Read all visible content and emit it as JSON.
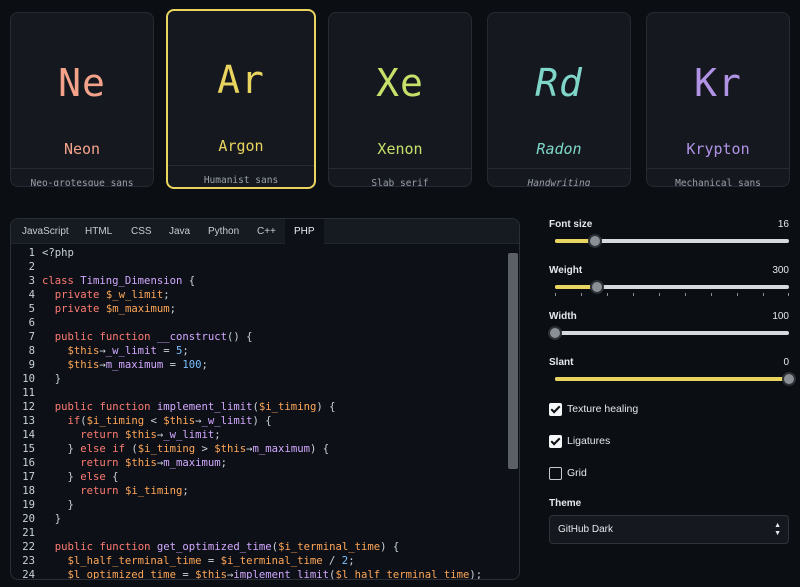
{
  "fonts": [
    {
      "symbol": "Ne",
      "name": "Neon",
      "description": "Neo-grotesque sans",
      "color": "#f4a38a",
      "selected": false
    },
    {
      "symbol": "Ar",
      "name": "Argon",
      "description": "Humanist sans",
      "color": "#e9d45f",
      "selected": true
    },
    {
      "symbol": "Xe",
      "name": "Xenon",
      "description": "Slab serif",
      "color": "#c6e06a",
      "selected": false
    },
    {
      "symbol": "Rd",
      "name": "Radon",
      "description": "Handwriting",
      "color": "#7fd6c8",
      "selected": false
    },
    {
      "symbol": "Kr",
      "name": "Krypton",
      "description": "Mechanical sans",
      "color": "#b193e6",
      "selected": false
    }
  ],
  "editor": {
    "tabs": [
      "JavaScript",
      "HTML",
      "CSS",
      "Java",
      "Python",
      "C++",
      "PHP"
    ],
    "active_tab": "PHP",
    "code_lines": [
      "<?php",
      "",
      "class Timing_Dimension {",
      "  private $_w_limit;",
      "  private $m_maximum;",
      "",
      "  public function __construct() {",
      "    $this→_w_limit = 5;",
      "    $this→m_maximum = 100;",
      "  }",
      "",
      "  public function implement_limit($i_timing) {",
      "    if($i_timing < $this→_w_limit) {",
      "      return $this→_w_limit;",
      "    } else if ($i_timing > $this→m_maximum) {",
      "      return $this→m_maximum;",
      "    } else {",
      "      return $i_timing;",
      "    }",
      "  }",
      "",
      "  public function get_optimized_time($i_terminal_time) {",
      "    $l_half_terminal_time = $i_terminal_time / 2;",
      "    $l_optimized_time = $this→implement_limit($l_half_terminal_time);"
    ]
  },
  "controls": {
    "font_size": {
      "label": "Font size",
      "value": "16",
      "fraction": 0.17
    },
    "weight": {
      "label": "Weight",
      "value": "300",
      "fraction": 0.18
    },
    "width": {
      "label": "Width",
      "value": "100",
      "fraction": 0.0
    },
    "slant": {
      "label": "Slant",
      "value": "0",
      "fraction": 1.0
    },
    "texture_healing": {
      "label": "Texture healing",
      "checked": true
    },
    "ligatures": {
      "label": "Ligatures",
      "checked": true
    },
    "grid": {
      "label": "Grid",
      "checked": false
    },
    "theme": {
      "label": "Theme",
      "value": "GitHub Dark"
    }
  },
  "colors": {
    "accent": "#e9d45f",
    "keyword": "#ff7b72",
    "function": "#d2a8ff",
    "variable": "#ffa657",
    "number": "#79c0ff"
  }
}
